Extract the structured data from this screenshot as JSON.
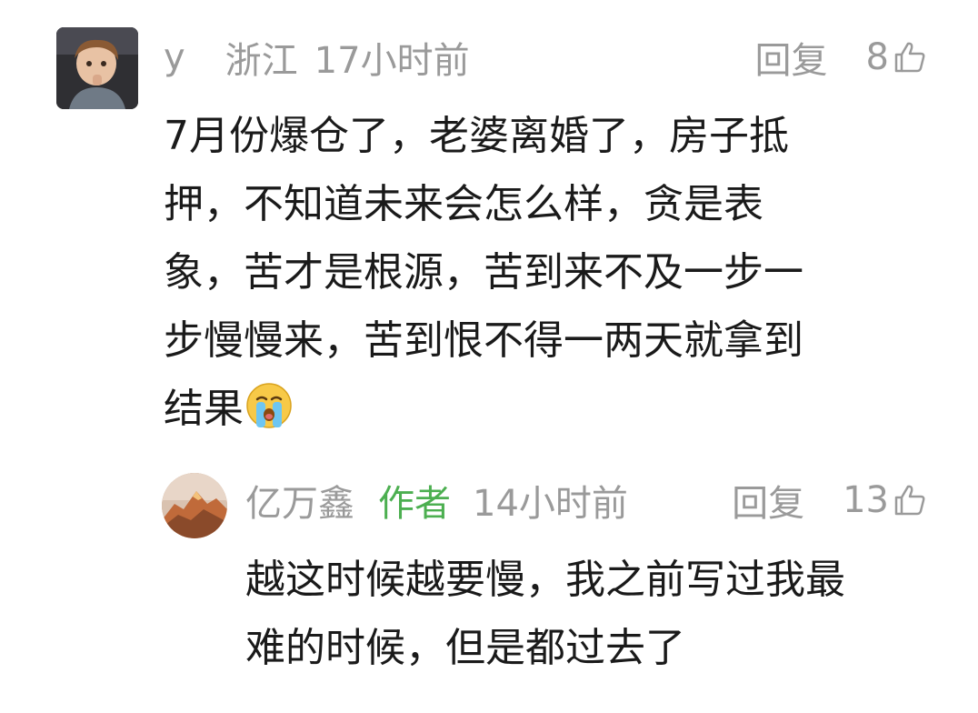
{
  "comment": {
    "username": "y",
    "region": "浙江",
    "time": "17小时前",
    "reply_label": "回复",
    "likes": "8",
    "avatar_icon": "child-photo-avatar",
    "lines": [
      "7月份爆仓了，老婆离婚了，房子抵",
      "押，不知道未来会怎么样，贪是表",
      "象，苦才是根源，苦到来不及一步一",
      "步慢慢来，苦到恨不得一两天就拿到",
      "结果"
    ],
    "emoji": "crying-face-emoji"
  },
  "reply": {
    "username": "亿万鑫",
    "author_tag": "作者",
    "time": "14小时前",
    "reply_label": "回复",
    "likes": "13",
    "avatar_icon": "mountain-sunset-avatar",
    "lines": [
      "越这时候越要慢，我之前写过我最",
      "难的时候，但是都过去了"
    ]
  },
  "colors": {
    "meta_gray": "#9a9a9a",
    "author_green": "#4caf50",
    "text": "#1a1a1a"
  }
}
